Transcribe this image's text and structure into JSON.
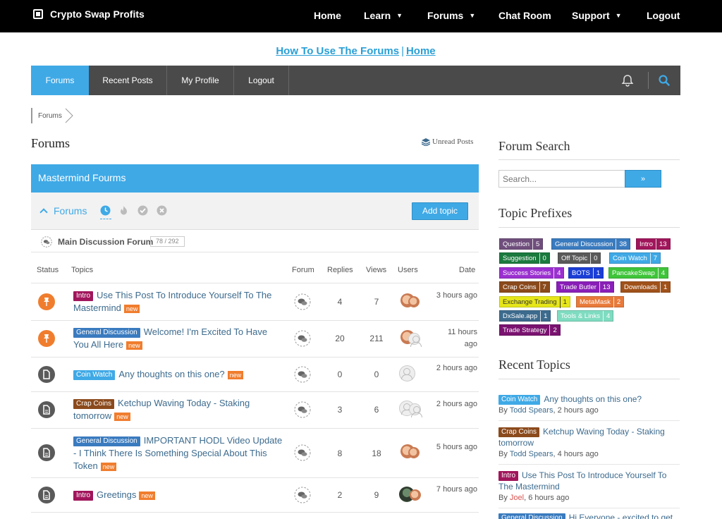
{
  "header": {
    "brand": "Crypto Swap Profits",
    "nav": [
      {
        "label": "Home"
      },
      {
        "label": "Learn"
      },
      {
        "label": "Forums"
      },
      {
        "label": "Chat Room"
      },
      {
        "label": "Support"
      },
      {
        "label": "Logout"
      }
    ]
  },
  "howto": {
    "link1": "How To Use The Forums",
    "sep": "|",
    "link2": "Home"
  },
  "forum_nav": {
    "items": [
      {
        "label": "Forums"
      },
      {
        "label": "Recent Posts"
      },
      {
        "label": "My Profile"
      },
      {
        "label": "Logout"
      }
    ],
    "icons": {
      "bell": "bell-icon",
      "search": "search-icon"
    }
  },
  "breadcrumb": {
    "item": "Forums"
  },
  "main": {
    "title": "Forums",
    "unread": "Unread Posts",
    "section_title": "Mastermind Fourms",
    "sub_label": "Forums",
    "add_topic": "Add topic",
    "forum_row": {
      "name": "Main Discussion Forum",
      "counts": "78 / 292"
    },
    "columns": {
      "status": "Status",
      "topics": "Topics",
      "forum": "Forum",
      "replies": "Replies",
      "views": "Views",
      "users": "Users",
      "date": "Date"
    },
    "topics": [
      {
        "status": "pinned",
        "tag": "Intro",
        "tag_color": "#a0165b",
        "title": "Use This Post To Introduce Yourself To The Mastermind",
        "new": "new",
        "replies": "4",
        "views": "7",
        "date": "3 hours ago"
      },
      {
        "status": "pinned",
        "tag": "General Discussion",
        "tag_color": "#3a7bbf",
        "title": "Welcome! I'm Excited To Have You All Here",
        "new": "new",
        "replies": "20",
        "views": "211",
        "date": "11 hours ago"
      },
      {
        "status": "normal",
        "tag": "Coin Watch",
        "tag_color": "#3fa9e6",
        "title": "Any thoughts on this one?",
        "new": "new",
        "replies": "0",
        "views": "0",
        "date": "2 hours ago"
      },
      {
        "status": "normal",
        "tag": "Crap Coins",
        "tag_color": "#8b4a1c",
        "title": "Ketchup Waving Today - Staking tomorrow",
        "new": "new",
        "replies": "3",
        "views": "6",
        "date": "2 hours ago"
      },
      {
        "status": "normal",
        "tag": "General Discussion",
        "tag_color": "#3a7bbf",
        "title": "IMPORTANT HODL Video Update - I Think There Is Something Special About This Token",
        "new": "new",
        "replies": "8",
        "views": "18",
        "date": "5 hours ago"
      },
      {
        "status": "normal",
        "tag": "Intro",
        "tag_color": "#a0165b",
        "title": "Greetings",
        "new": "new",
        "replies": "2",
        "views": "9",
        "date": "7 hours ago"
      }
    ]
  },
  "sidebar": {
    "search_title": "Forum Search",
    "search_placeholder": "Search...",
    "search_button": "»",
    "prefix_title": "Topic Prefixes",
    "prefixes": [
      {
        "name": "Question",
        "count": "5",
        "color": "#6f4e7c"
      },
      {
        "name": "General Discussion",
        "count": "38",
        "color": "#3a7bbf"
      },
      {
        "name": "Intro",
        "count": "13",
        "color": "#a0165b"
      },
      {
        "name": "Suggestion",
        "count": "0",
        "color": "#1b7a3e"
      },
      {
        "name": "Off Topic",
        "count": "0",
        "color": "#5a5a5a"
      },
      {
        "name": "Coin Watch",
        "count": "7",
        "color": "#3fa9e6"
      },
      {
        "name": "Success Stories",
        "count": "4",
        "color": "#9b30d0"
      },
      {
        "name": "BOTS",
        "count": "1",
        "color": "#1a3ed6"
      },
      {
        "name": "PancakeSwap",
        "count": "4",
        "color": "#3fc43a"
      },
      {
        "name": "Crap Coins",
        "count": "7",
        "color": "#8b4a1c"
      },
      {
        "name": "Trade Butler",
        "count": "13",
        "color": "#8a1fb8"
      },
      {
        "name": "Downloads",
        "count": "1",
        "color": "#a0521a"
      },
      {
        "name": "Exchange Trading",
        "count": "1",
        "color": "#e6e619"
      },
      {
        "name": "MetaMask",
        "count": "2",
        "color": "#e87a3a"
      },
      {
        "name": "DxSale.app",
        "count": "1",
        "color": "#3d6b8e"
      },
      {
        "name": "Tools & Links",
        "count": "4",
        "color": "#7fdcc0"
      },
      {
        "name": "Trade Strategy",
        "count": "2",
        "color": "#7a1370"
      }
    ],
    "recent_title": "Recent Topics",
    "recent": [
      {
        "tag": "Coin Watch",
        "tag_color": "#3fa9e6",
        "title": "Any thoughts on this one?",
        "by": "By",
        "author": "Todd Spears",
        "when": ", 2 hours ago"
      },
      {
        "tag": "Crap Coins",
        "tag_color": "#8b4a1c",
        "title": "Ketchup Waving Today - Staking tomorrow",
        "by": "By",
        "author": "Todd Spears",
        "when": ", 4 hours ago"
      },
      {
        "tag": "Intro",
        "tag_color": "#a0165b",
        "title": "Use This Post To Introduce Yourself To The Mastermind",
        "by": "By",
        "author": "Joel",
        "when": ", 6 hours ago"
      },
      {
        "tag": "General Discussion",
        "tag_color": "#3a7bbf",
        "title": "Hi Everyone - excited to get"
      }
    ]
  }
}
